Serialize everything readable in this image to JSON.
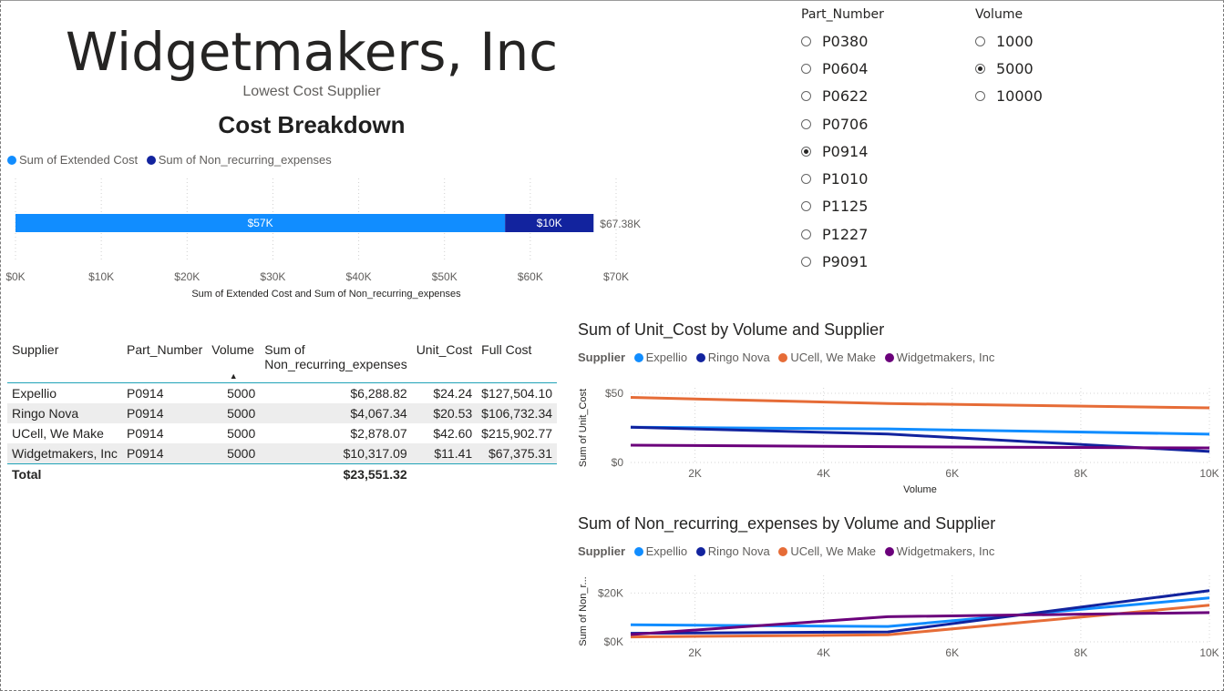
{
  "header": {
    "title": "Widgetmakers, Inc",
    "subtitle": "Lowest Cost Supplier",
    "chart_heading": "Cost Breakdown"
  },
  "slicers": {
    "part": {
      "header": "Part_Number",
      "options": [
        "P0380",
        "P0604",
        "P0622",
        "P0706",
        "P0914",
        "P1010",
        "P1125",
        "P1227",
        "P9091"
      ],
      "selected": "P0914"
    },
    "volume": {
      "header": "Volume",
      "options": [
        "1000",
        "5000",
        "10000"
      ],
      "selected": "5000"
    }
  },
  "colors": {
    "extended": "#118dff",
    "nonrecurring": "#12239e",
    "expellio": "#118dff",
    "ringo": "#12239e",
    "ucell": "#e66c37",
    "widget": "#6b007b"
  },
  "table": {
    "headers": [
      "Supplier",
      "Part_Number",
      "Volume",
      "Sum of Non_recurring_expenses",
      "Unit_Cost",
      "Full Cost"
    ],
    "rows": [
      [
        "Expellio",
        "P0914",
        "5000",
        "$6,288.82",
        "$24.24",
        "$127,504.10"
      ],
      [
        "Ringo Nova",
        "P0914",
        "5000",
        "$4,067.34",
        "$20.53",
        "$106,732.34"
      ],
      [
        "UCell, We Make",
        "P0914",
        "5000",
        "$2,878.07",
        "$42.60",
        "$215,902.77"
      ],
      [
        "Widgetmakers, Inc",
        "P0914",
        "5000",
        "$10,317.09",
        "$11.41",
        "$67,375.31"
      ]
    ],
    "total_label": "Total",
    "total_value": "$23,551.32"
  },
  "chart_data": [
    {
      "type": "bar",
      "orientation": "horizontal-stacked",
      "series": [
        {
          "name": "Sum of Extended Cost",
          "values": [
            57058
          ]
        },
        {
          "name": "Sum of Non_recurring_expenses",
          "values": [
            10317
          ]
        }
      ],
      "data_labels": [
        "$57K",
        "$10K"
      ],
      "total_label": "$67.38K",
      "x_ticks": [
        "$0K",
        "$10K",
        "$20K",
        "$30K",
        "$40K",
        "$50K",
        "$60K",
        "$70K"
      ],
      "xlim": [
        0,
        70000
      ],
      "xlabel": "Sum of Extended Cost and Sum of Non_recurring_expenses",
      "legend": "top-left",
      "grid": true
    },
    {
      "type": "line",
      "title": "Sum of Unit_Cost by Volume and Supplier",
      "legend_title": "Supplier",
      "x": [
        1000,
        5000,
        10000
      ],
      "series": [
        {
          "name": "Expellio",
          "values": [
            25.5,
            24.24,
            20.5
          ]
        },
        {
          "name": "Ringo Nova",
          "values": [
            25.5,
            20.53,
            8.0
          ]
        },
        {
          "name": "UCell, We Make",
          "values": [
            47.0,
            42.6,
            39.5
          ]
        },
        {
          "name": "Widgetmakers, Inc",
          "values": [
            12.5,
            11.41,
            10.5
          ]
        }
      ],
      "xlabel": "Volume",
      "ylabel": "Sum of Unit_Cost",
      "x_ticks": [
        "2K",
        "4K",
        "6K",
        "8K",
        "10K"
      ],
      "y_ticks": [
        "$0",
        "$50"
      ],
      "xlim": [
        1000,
        10000
      ],
      "ylim": [
        0,
        50
      ],
      "legend": "top-left",
      "grid": true
    },
    {
      "type": "line",
      "title": "Sum of Non_recurring_expenses by Volume and Supplier",
      "legend_title": "Supplier",
      "x": [
        1000,
        5000,
        10000
      ],
      "series": [
        {
          "name": "Expellio",
          "values": [
            7000,
            6289,
            18000
          ]
        },
        {
          "name": "Ringo Nova",
          "values": [
            3500,
            4067,
            21000
          ]
        },
        {
          "name": "UCell, We Make",
          "values": [
            2000,
            2878,
            15000
          ]
        },
        {
          "name": "Widgetmakers, Inc",
          "values": [
            3000,
            10317,
            12000
          ]
        }
      ],
      "ylabel": "Sum of Non_r...",
      "x_ticks": [
        "2K",
        "4K",
        "6K",
        "8K",
        "10K"
      ],
      "y_ticks": [
        "$0K",
        "$20K"
      ],
      "xlim": [
        1000,
        10000
      ],
      "ylim": [
        0,
        25000
      ],
      "legend": "top-left",
      "grid": true
    }
  ]
}
